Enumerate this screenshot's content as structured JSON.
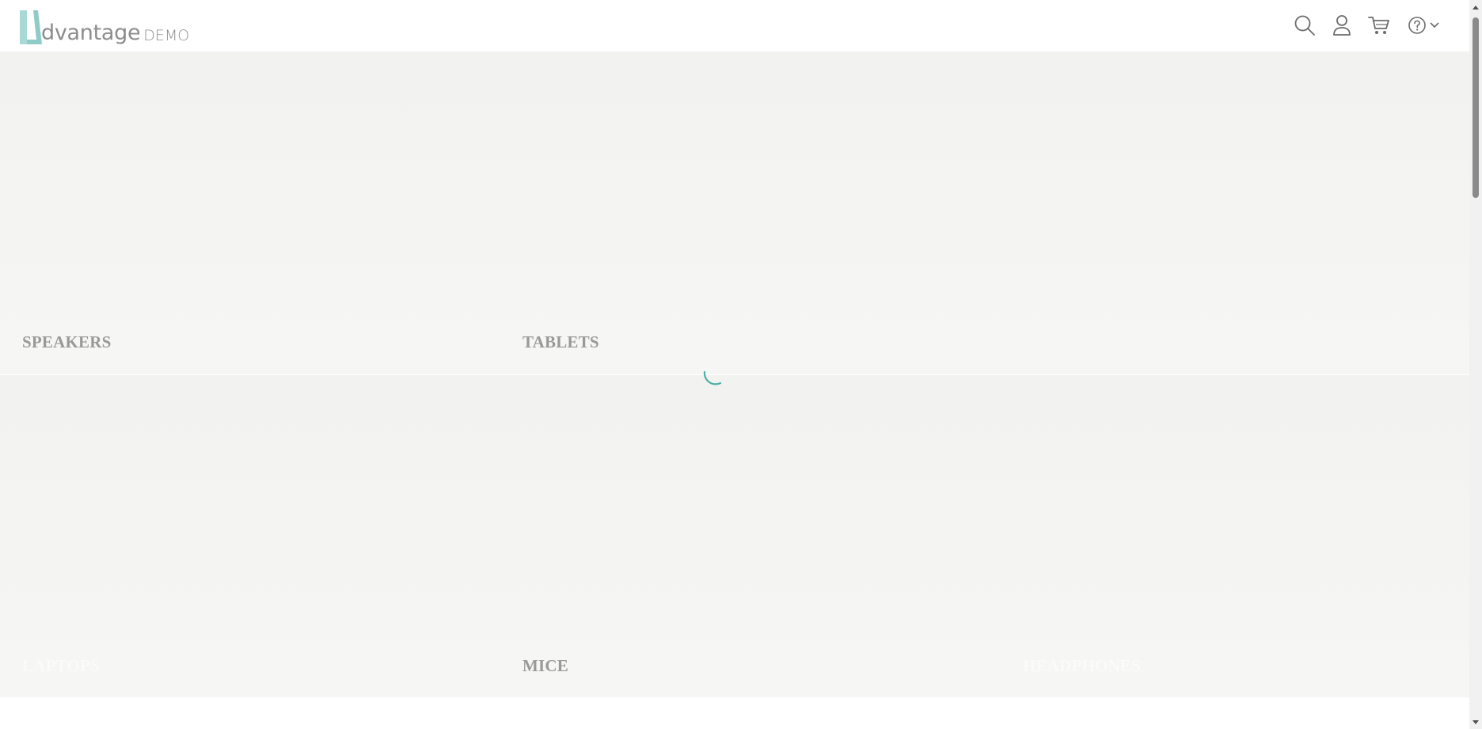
{
  "header": {
    "logo_text": "dvantage",
    "logo_suffix": "DEMO",
    "icons": {
      "search": "search-icon",
      "user": "user-icon",
      "cart": "cart-icon",
      "help": "help-icon"
    }
  },
  "categories": {
    "speakers": "SPEAKERS",
    "tablets": "TABLETS",
    "laptops": "LAPTOPS",
    "mice": "MICE",
    "headphones": "HEADPHONES"
  },
  "colors": {
    "brand_teal": "#9ed3cf",
    "spinner": "#3aa8a0",
    "label_gray": "#999999",
    "tile_bg": "#f3f3f1"
  },
  "loading": {
    "indicator": "spinner-icon"
  }
}
